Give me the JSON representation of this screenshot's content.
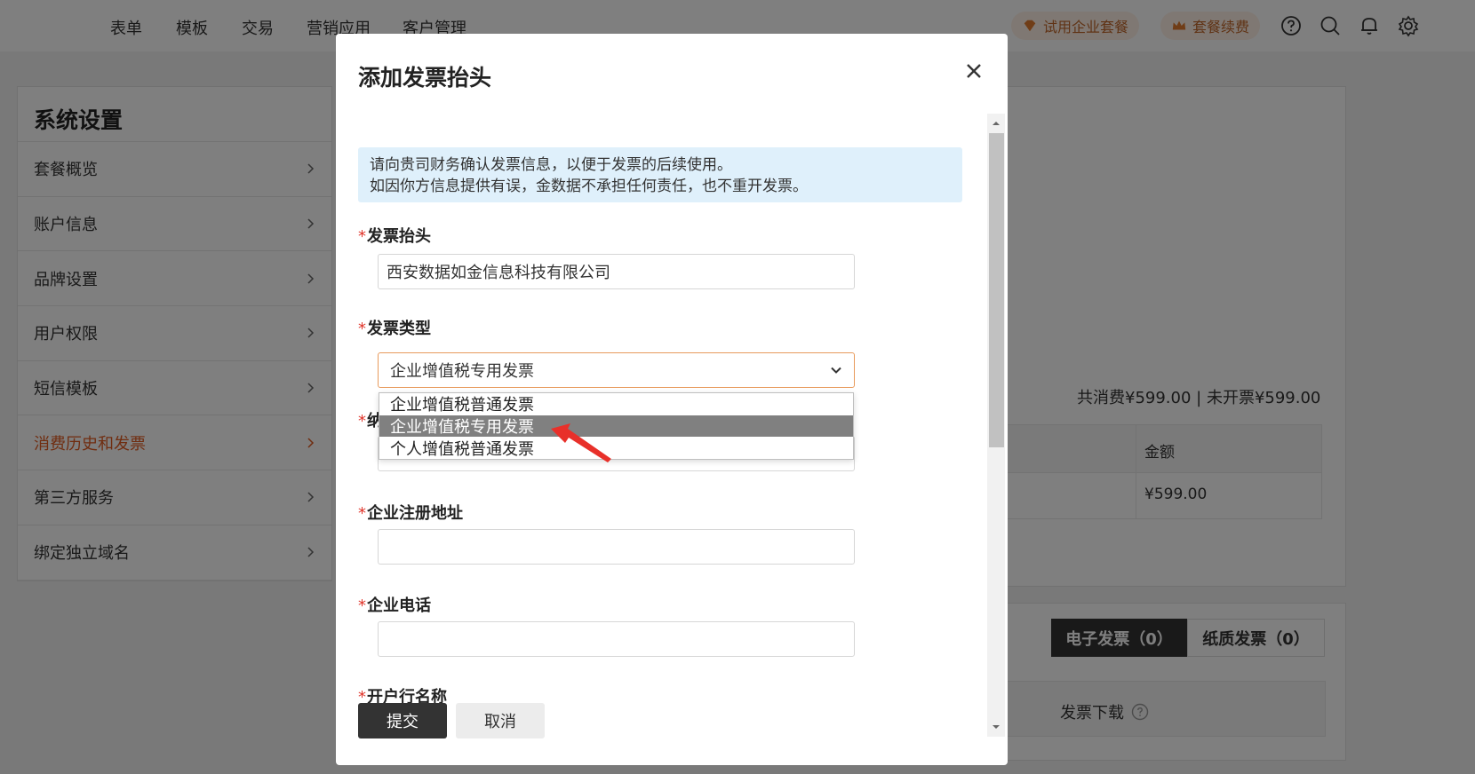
{
  "topnav": {
    "items": [
      "表单",
      "模板",
      "交易",
      "营销应用",
      "客户管理"
    ],
    "trial_label": "试用企业套餐",
    "renew_label": "套餐续费",
    "accent": "#c0662a"
  },
  "settings": {
    "title": "系统设置",
    "items": [
      {
        "label": "套餐概览"
      },
      {
        "label": "账户信息"
      },
      {
        "label": "品牌设置"
      },
      {
        "label": "用户权限"
      },
      {
        "label": "短信模板"
      },
      {
        "label": "消费历史和发票"
      },
      {
        "label": "第三方服务"
      },
      {
        "label": "绑定独立域名"
      }
    ],
    "active_index": 5,
    "active_color": "#e05a20"
  },
  "content": {
    "summary": "共消费¥599.00 | 未开票¥599.00",
    "table_header_amount": "金额",
    "table_row_amount": "¥599.00",
    "tab_electronic": "电子发票（0）",
    "tab_paper": "纸质发票（0）",
    "download_label": "发票下载"
  },
  "modal": {
    "title": "添加发票抬头",
    "notice_line1": "请向贵司财务确认发票信息，以便于发票的后续使用。",
    "notice_line2": "如因你方信息提供有误，金数据不承担任何责任，也不重开发票。",
    "fields": {
      "invoice_title": {
        "label": "发票抬头",
        "value": "西安数据如金信息科技有限公司"
      },
      "invoice_type": {
        "label": "发票类型",
        "value": "企业增值税专用发票"
      },
      "taxpayer_id": {
        "label": "纳",
        "value": ""
      },
      "reg_address": {
        "label": "企业注册地址",
        "value": ""
      },
      "phone": {
        "label": "企业电话",
        "value": ""
      },
      "bank_name": {
        "label": "开户行名称",
        "value": ""
      }
    },
    "required_mark": "*",
    "dropdown_options": [
      "企业增值税普通发票",
      "企业增值税专用发票",
      "个人增值税普通发票"
    ],
    "dropdown_selected_index": 1,
    "submit_label": "提交",
    "cancel_label": "取消"
  }
}
